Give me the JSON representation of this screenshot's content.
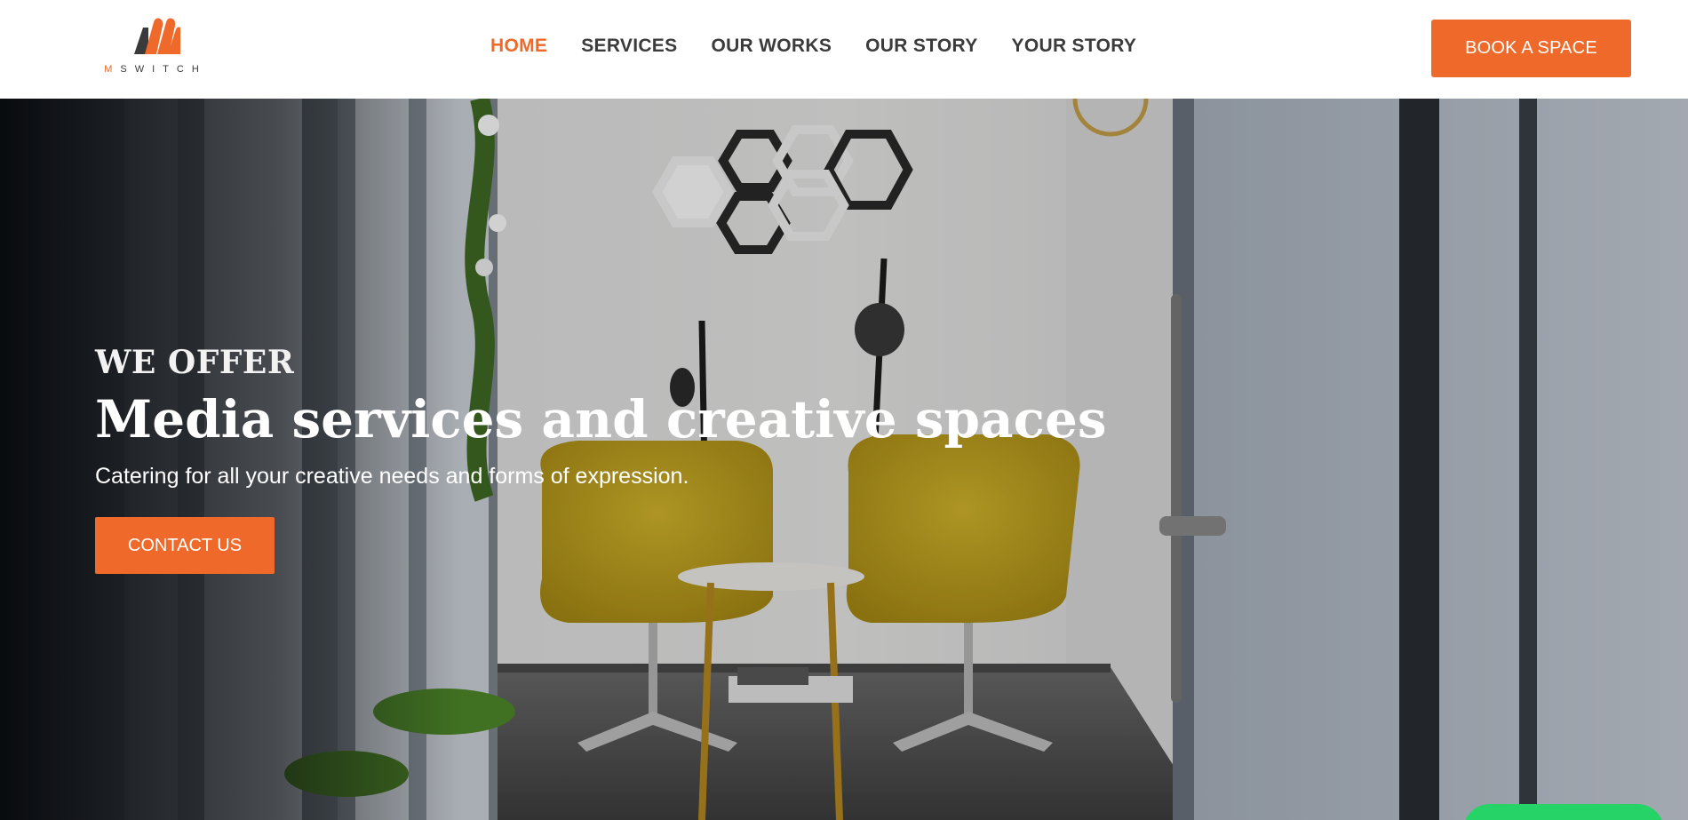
{
  "brand": {
    "logo_text_initial": "M",
    "logo_text_rest": "SWITCH",
    "accent_color": "#ef6a2a"
  },
  "nav": {
    "items": [
      {
        "label": "HOME",
        "active": true
      },
      {
        "label": "SERVICES",
        "active": false
      },
      {
        "label": "OUR WORKS",
        "active": false
      },
      {
        "label": "OUR STORY",
        "active": false
      },
      {
        "label": "YOUR STORY",
        "active": false
      }
    ],
    "cta_label": "BOOK A SPACE"
  },
  "hero": {
    "eyebrow": "WE OFFER",
    "headline": "Media services and creative spaces",
    "subline": "Catering for all your creative needs and forms of expression.",
    "cta_label": "CONTACT US",
    "background_image": "podcast studio with two yellow chairs, microphones and a small round table"
  },
  "chat_widget": {
    "icon": "chat-bubble-icon",
    "color": "#25d366"
  }
}
